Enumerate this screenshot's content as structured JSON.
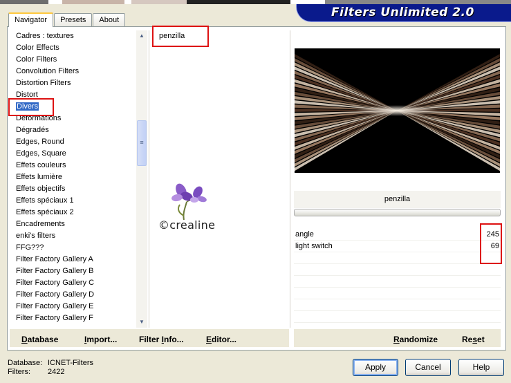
{
  "top_strip_colors": [
    "#6e6e6e",
    "#ffffff",
    "#c8b4a8",
    "#ffffff",
    "#d6c8c0",
    "#222222",
    "#ffffff",
    "#888888"
  ],
  "banner": {
    "title": "Filters Unlimited 2.0"
  },
  "tabs": [
    {
      "label": "Navigator",
      "active": true
    },
    {
      "label": "Presets",
      "active": false
    },
    {
      "label": "About",
      "active": false
    }
  ],
  "categories": [
    "Cadres : textures",
    "Color Effects",
    "Color Filters",
    "Convolution Filters",
    "Distortion Filters",
    "Distort",
    "Divers",
    "Déformations",
    "Dégradés",
    "Edges, Round",
    "Edges, Square",
    "Effets couleurs",
    "Effets lumière",
    "Effets objectifs",
    "Effets spéciaux 1",
    "Effets spéciaux 2",
    "Encadrements",
    "enki's filters",
    "FFG???",
    "Filter Factory Gallery A",
    "Filter Factory Gallery B",
    "Filter Factory Gallery C",
    "Filter Factory Gallery D",
    "Filter Factory Gallery E",
    "Filter Factory Gallery F"
  ],
  "selected_category": "Divers",
  "filters": [
    "penzilla"
  ],
  "watermark": {
    "text": "©crealine"
  },
  "selected_filter_name": "penzilla",
  "params": [
    {
      "label": "angle",
      "value": "245"
    },
    {
      "label": "light switch",
      "value": "69"
    }
  ],
  "left_buttons": [
    {
      "pre": "",
      "u": "D",
      "post": "atabase"
    },
    {
      "pre": "",
      "u": "I",
      "post": "mport..."
    },
    {
      "pre": "Filter ",
      "u": "I",
      "post": "nfo..."
    },
    {
      "pre": "",
      "u": "E",
      "post": "ditor..."
    }
  ],
  "right_buttons": [
    {
      "pre": "",
      "u": "R",
      "post": "andomize"
    },
    {
      "pre": "Re",
      "u": "s",
      "post": "et"
    }
  ],
  "footer": {
    "database_label": "Database:",
    "database_value": "ICNET-Filters",
    "filters_label": "Filters:",
    "filters_value": "2422"
  },
  "dialog_buttons": {
    "apply": "Apply",
    "cancel": "Cancel",
    "help": "Help"
  },
  "colors": {
    "selection": "#3169c6",
    "banner": "#0a1a8c",
    "annotation": "#dd1111"
  },
  "icons": {
    "scroll_up": "scroll-up-arrow-icon",
    "scroll_down": "scroll-down-arrow-icon",
    "watermark_flower": "iris-flower-icon"
  }
}
